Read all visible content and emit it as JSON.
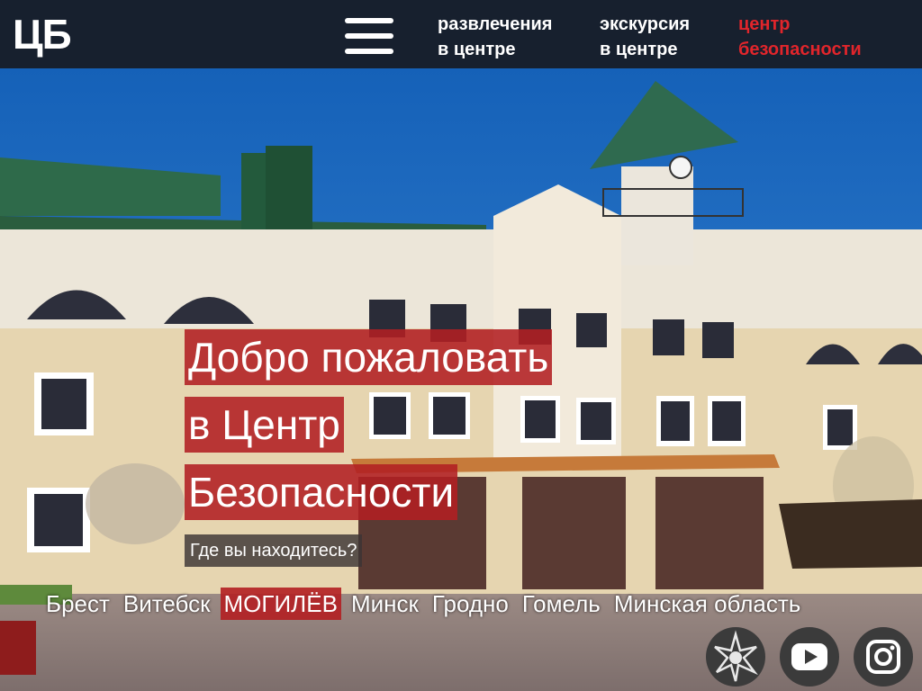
{
  "header": {
    "logo": "ЦБ",
    "nav": [
      {
        "line1": "развлечения",
        "line2": "в центре"
      },
      {
        "line1": "экскурсия",
        "line2": "в центре"
      },
      {
        "line1": "центр",
        "line2": "безопасности"
      }
    ],
    "active_color": "#e1252b",
    "bg_color": "#17202e"
  },
  "hero": {
    "title_lines": [
      "Добро пожаловать",
      "в Центр",
      "Безопасности"
    ],
    "question": "Где вы находитесь?",
    "highlight_color": "#b21f22"
  },
  "cities": [
    {
      "label": "Брест",
      "active": false
    },
    {
      "label": "Витебск",
      "active": false
    },
    {
      "label": "МОГИЛЁВ",
      "active": true
    },
    {
      "label": "Минск",
      "active": false
    },
    {
      "label": "Гродно",
      "active": false
    },
    {
      "label": "Гомель",
      "active": false
    },
    {
      "label": "Минская область",
      "active": false
    }
  ],
  "social": [
    {
      "icon": "emergency-star-icon"
    },
    {
      "icon": "youtube-icon"
    },
    {
      "icon": "instagram-icon"
    }
  ]
}
